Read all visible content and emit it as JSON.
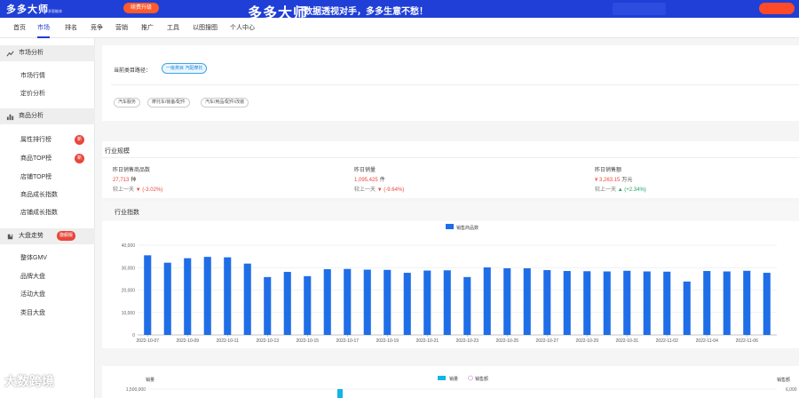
{
  "header": {
    "logo": "多多大师",
    "logo_sub": "多多智能体",
    "upgrade_label": "续费升级",
    "banner_title": "多多大师",
    "banner_slogan": "数据透视对手，多多生意不愁！"
  },
  "nav": {
    "items": [
      "首页",
      "市场",
      "排名",
      "竞争",
      "营销",
      "推广",
      "工具",
      "以图搜图",
      "个人中心"
    ],
    "active_index": 1
  },
  "sidebar": {
    "sections": [
      {
        "label": "市场分析",
        "icon": "trend-icon",
        "items": [
          {
            "label": "市场行情"
          },
          {
            "label": "定价分析"
          }
        ]
      },
      {
        "label": "商品分析",
        "icon": "bar-chart-icon",
        "items": [
          {
            "label": "属性排行榜",
            "badge": "新"
          },
          {
            "label": "商品TOP榜",
            "badge": "新"
          },
          {
            "label": "店铺TOP榜"
          },
          {
            "label": "商品成长指数"
          },
          {
            "label": "店铺成长指数"
          }
        ]
      },
      {
        "label": "大盘走势",
        "icon": "puzzle-icon",
        "badge": "旗舰版",
        "items": [
          {
            "label": "整体GMV"
          },
          {
            "label": "品牌大盘"
          },
          {
            "label": "活动大盘"
          },
          {
            "label": "类目大盘"
          }
        ]
      }
    ]
  },
  "category": {
    "path_label": "当前类目路径：",
    "path_value": "一级类目 汽配摩托",
    "tags": [
      "汽车服务",
      "摩托车/装备/配件",
      "汽车/用品/配件/改装"
    ]
  },
  "industry": {
    "title": "行业规模",
    "metrics": [
      {
        "label": "昨日销售商品数",
        "value": "27,713",
        "unit": "种",
        "cmp_label": "较上一天",
        "cmp_value": "(-3.02%)",
        "direction": "down"
      },
      {
        "label": "昨日销量",
        "value": "1,095,425",
        "unit": "件",
        "cmp_label": "较上一天",
        "cmp_value": "(-9.64%)",
        "direction": "down"
      },
      {
        "label": "昨日销售额",
        "value": "¥ 3,263.15",
        "unit": "万元",
        "cmp_label": "较上一天",
        "cmp_value": "(+2.34%)",
        "direction": "up"
      }
    ]
  },
  "indicator": {
    "title": "行业指数"
  },
  "chart_data": [
    {
      "type": "bar",
      "legend": "销售商品数",
      "color": "#1f6ee8",
      "ylim": [
        0,
        40000
      ],
      "yticks": [
        "0",
        "10,000",
        "20,000",
        "30,000",
        "40,000"
      ],
      "x_tick_labels": [
        "2022-10-07",
        "2022-10-09",
        "2022-10-11",
        "2022-10-13",
        "2022-10-15",
        "2022-10-17",
        "2022-10-19",
        "2022-10-21",
        "2022-10-23",
        "2022-10-25",
        "2022-10-27",
        "2022-10-29",
        "2022-10-31",
        "2022-11-02",
        "2022-11-04",
        "2022-11-06"
      ],
      "categories": [
        "2022-10-07",
        "2022-10-08",
        "2022-10-09",
        "2022-10-10",
        "2022-10-11",
        "2022-10-12",
        "2022-10-13",
        "2022-10-14",
        "2022-10-15",
        "2022-10-16",
        "2022-10-17",
        "2022-10-18",
        "2022-10-19",
        "2022-10-20",
        "2022-10-21",
        "2022-10-22",
        "2022-10-23",
        "2022-10-24",
        "2022-10-25",
        "2022-10-26",
        "2022-10-27",
        "2022-10-28",
        "2022-10-29",
        "2022-10-30",
        "2022-10-31",
        "2022-11-01",
        "2022-11-02",
        "2022-11-03",
        "2022-11-04",
        "2022-11-05",
        "2022-11-06",
        "2022-11-07"
      ],
      "values": [
        35500,
        32200,
        34200,
        34800,
        34600,
        31800,
        25800,
        28100,
        26200,
        29300,
        29400,
        29100,
        29000,
        27700,
        28700,
        28800,
        25800,
        30100,
        29700,
        29700,
        28900,
        28500,
        28400,
        28300,
        28600,
        28300,
        28200,
        23800,
        28500,
        28300,
        28600,
        27700
      ]
    },
    {
      "type": "bar",
      "legend_series": [
        "销量",
        "销售额"
      ],
      "y_left_label": "销量",
      "y_left_top": "1,500,000",
      "y_right_label": "销售额",
      "y_right_top": "6,000"
    }
  ],
  "watermark": "大数跨境"
}
